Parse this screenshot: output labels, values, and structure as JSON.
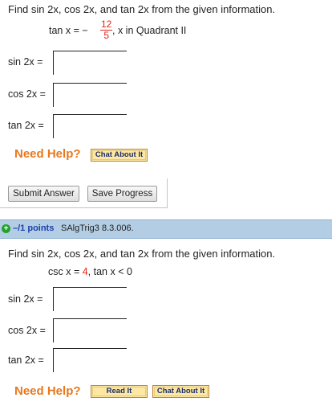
{
  "q1": {
    "prompt": "Find sin 2x, cos 2x, and tan 2x from the given information.",
    "given_prefix": "tan x = −",
    "given_num": "12",
    "given_den": "5",
    "given_suffix": ",   x in Quadrant II",
    "labels": [
      "sin 2x =",
      "cos 2x =",
      "tan 2x ="
    ],
    "need_help": "Need Help?",
    "chat_label": "Chat About It"
  },
  "actions": {
    "submit_label": "Submit Answer",
    "save_label": "Save Progress"
  },
  "q2": {
    "points": "–/1 points",
    "qid": "SAlgTrig3 8.3.006.",
    "prompt": "Find sin 2x, cos 2x, and tan 2x from the given information.",
    "given_prefix": "csc x = ",
    "given_value": "4",
    "given_suffix": ",    tan x < 0",
    "labels": [
      "sin 2x =",
      "cos 2x =",
      "tan 2x ="
    ],
    "need_help": "Need Help?",
    "read_label": "Read It",
    "chat_label": "Chat About It"
  },
  "colors": {
    "accent_orange": "#e8781e",
    "value_red": "#e0261b",
    "link_blue": "#1d3ea8",
    "bar_blue": "#b3cde4",
    "help_button_bg": "#fde8a3"
  },
  "icons": [
    "plus-icon"
  ]
}
